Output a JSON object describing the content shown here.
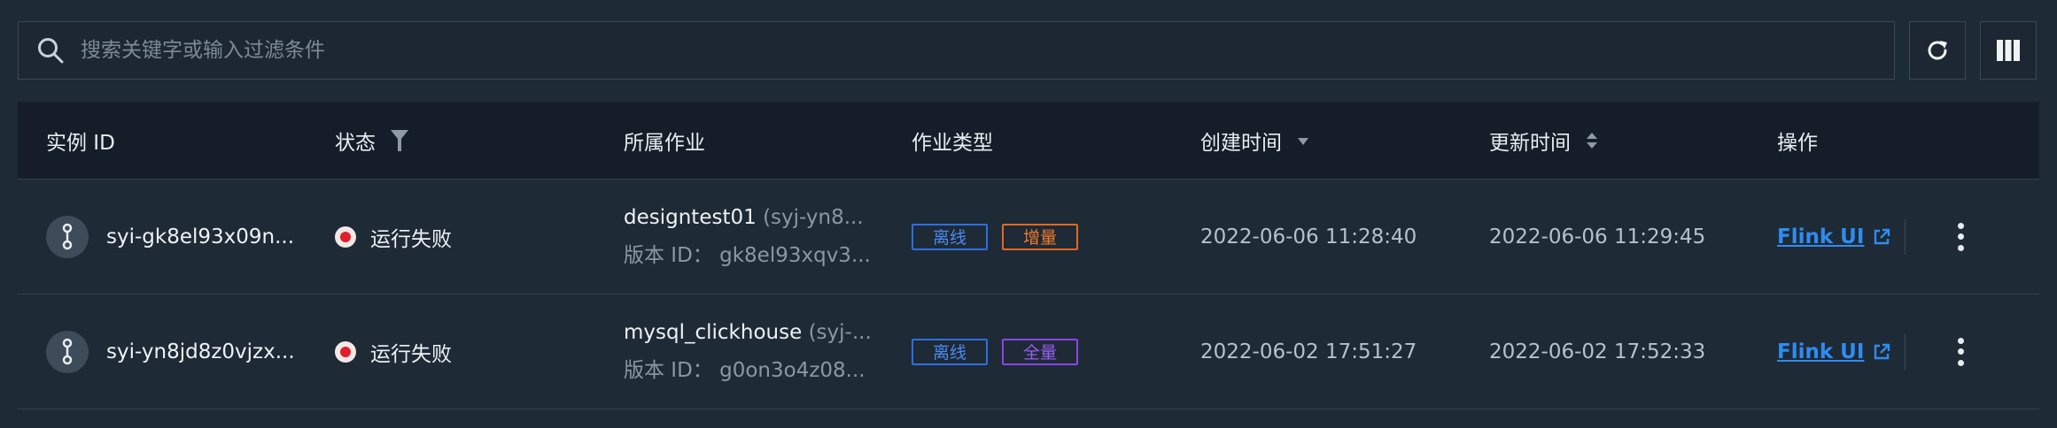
{
  "search": {
    "placeholder": "搜索关键字或输入过滤条件"
  },
  "toolbar": {
    "refresh_icon": "refresh-icon",
    "columns_icon": "columns-icon"
  },
  "table": {
    "headers": {
      "instance_id": "实例 ID",
      "status": "状态",
      "job": "所属作业",
      "job_type": "作业类型",
      "created": "创建时间",
      "updated": "更新时间",
      "actions": "操作"
    },
    "rows": [
      {
        "instance_id": "syi-gk8el93x09n...",
        "status": "运行失败",
        "job_name": "designtest01",
        "job_sub": "(syj-yn8...",
        "version_label": "版本 ID：",
        "version_id": "gk8el93xqv3...",
        "tags": [
          "离线",
          "增量"
        ],
        "created": "2022-06-06 11:28:40",
        "updated": "2022-06-06 11:29:45",
        "action_link": "Flink UI"
      },
      {
        "instance_id": "syi-yn8jd8z0vjzx...",
        "status": "运行失败",
        "job_name": "mysql_clickhouse",
        "job_sub": "(syj-...",
        "version_label": "版本 ID：",
        "version_id": "g0on3o4z08...",
        "tags": [
          "离线",
          "全量"
        ],
        "created": "2022-06-02 17:51:27",
        "updated": "2022-06-02 17:52:33",
        "action_link": "Flink UI"
      }
    ]
  },
  "colors": {
    "background": "#1e2a36",
    "header": "#151e28",
    "link": "#2f8cf0",
    "status_failed": "#e0202a",
    "tag_offline": "#2f6fe0",
    "tag_incremental": "#e4681f",
    "tag_full": "#8a45e6"
  }
}
